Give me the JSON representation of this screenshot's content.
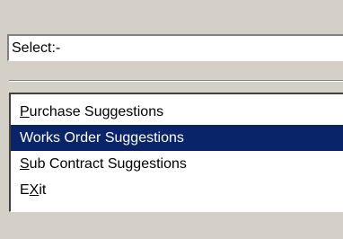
{
  "select": {
    "label": "Select:-"
  },
  "menu": {
    "items": [
      {
        "accel": "P",
        "rest": "urchase Suggestions",
        "selected": false
      },
      {
        "text": "Works Order Suggestions",
        "selected": true
      },
      {
        "accel": "S",
        "rest": "ub Contract Suggestions",
        "selected": false
      },
      {
        "pre": "E",
        "accel": "X",
        "rest": "it",
        "selected": false
      }
    ]
  },
  "colors": {
    "window_bg": "#d4d0c8",
    "selection_bg": "#0a246a",
    "selection_text": "#ffffff"
  }
}
